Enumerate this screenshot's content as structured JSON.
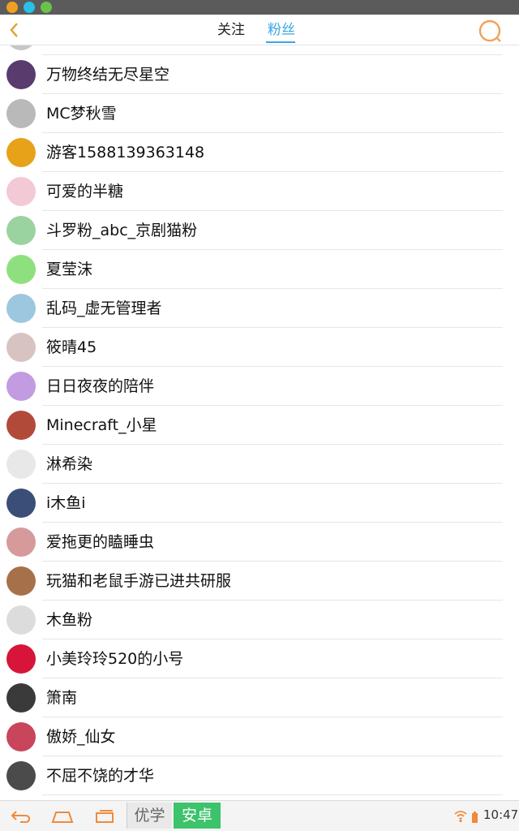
{
  "header": {
    "tab_follow": "关注",
    "tab_fans": "粉丝",
    "back_icon": "chevron-left-icon",
    "search_icon": "search-icon"
  },
  "followers": [
    {
      "name": "万物终结无尽星空",
      "avatar_color": "#5a3b6e"
    },
    {
      "name": "MC梦秋雪",
      "avatar_color": "#b9b9b9"
    },
    {
      "name": "游客1588139363148",
      "avatar_color": "#e7a21a"
    },
    {
      "name": "可爱的半糖",
      "avatar_color": "#f3c9d6"
    },
    {
      "name": "斗罗粉_abc_京剧猫粉",
      "avatar_color": "#9ad3a0"
    },
    {
      "name": "夏莹沫",
      "avatar_color": "#8ee07f"
    },
    {
      "name": "乱码_虚无管理者",
      "avatar_color": "#9cc7df"
    },
    {
      "name": "筱晴45",
      "avatar_color": "#d8c3c3"
    },
    {
      "name": "日日夜夜的陪伴",
      "avatar_color": "#c29be0"
    },
    {
      "name": "Minecraft_小星",
      "avatar_color": "#b24a3a"
    },
    {
      "name": "淋希染",
      "avatar_color": "#e8e8e8"
    },
    {
      "name": "i木鱼i",
      "avatar_color": "#3b4e78"
    },
    {
      "name": "爱拖更的瞌睡虫",
      "avatar_color": "#d69a9a"
    },
    {
      "name": "玩猫和老鼠手游已进共研服",
      "avatar_color": "#a6714a"
    },
    {
      "name": "木鱼粉",
      "avatar_color": "#dcdcdc"
    },
    {
      "name": "小美玲玲520的小号",
      "avatar_color": "#d7143a"
    },
    {
      "name": "箫南",
      "avatar_color": "#3a3a3a"
    },
    {
      "name": "傲娇_仙女",
      "avatar_color": "#c9455c"
    },
    {
      "name": "不屈不饶的才华",
      "avatar_color": "#4b4b4b"
    }
  ],
  "navbar": {
    "back_icon": "back-arrow-icon",
    "home_icon": "home-icon",
    "recents_icon": "recents-icon",
    "btn_youxue": "优学",
    "btn_anzhuo": "安卓",
    "time": "10:47",
    "wifi_icon": "wifi-icon",
    "battery_icon": "battery-icon"
  },
  "colors": {
    "accent": "#3aa6e6",
    "search_ring": "#f2a25a",
    "back_chevron": "#e0a030",
    "nav_orange": "#f08a3a",
    "green_button": "#3cc36b"
  }
}
